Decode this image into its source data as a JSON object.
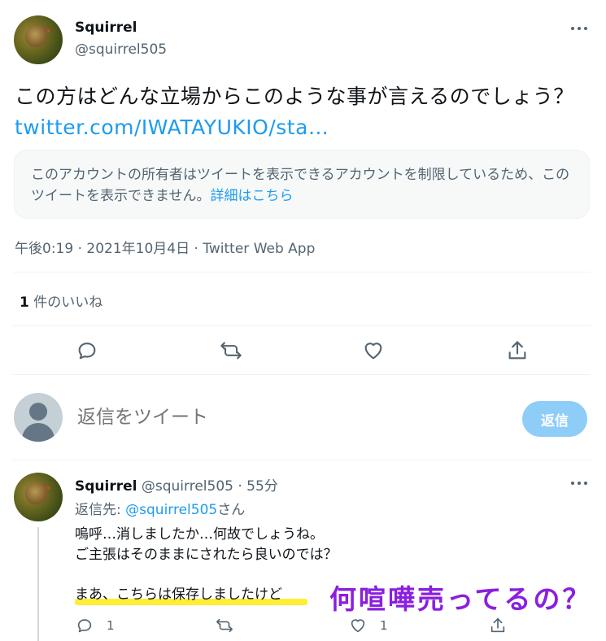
{
  "main_tweet": {
    "display_name": "Squirrel",
    "handle": "@squirrel505",
    "text": "この方はどんな立場からこのような事が言えるのでしょう？",
    "link": "twitter.com/IWATAYUKIO/sta…",
    "notice_text": "このアカウントの所有者はツイートを表示できるアカウントを制限しているため、このツイートを表示できません。",
    "notice_link": "詳細はこちら",
    "meta": "午後0:19 · 2021年10月4日 · Twitter Web App",
    "likes_count": "1",
    "likes_label": "件のいいね"
  },
  "compose": {
    "placeholder": "返信をツイート",
    "button_label": "返信"
  },
  "reply_tweet": {
    "display_name": "Squirrel",
    "handle": "@squirrel505",
    "time": "· 55分",
    "replying_prefix": "返信先:",
    "replying_handle": "@squirrel505",
    "replying_suffix": "さん",
    "line1": "嗚呼…消しましたか…何故でしょうね。",
    "line2": "ご主張はそのままにされたら良いのでは？",
    "line3": "まあ、こちらは保存しましたけど",
    "reply_count": "1",
    "like_count": "1"
  },
  "overlay_text": "何喧嘩売ってるの？",
  "icons": [
    "more-icon",
    "reply-icon",
    "retweet-icon",
    "like-icon",
    "share-icon",
    "default-avatar-icon"
  ],
  "colors": {
    "link": "#1d9bf0",
    "muted": "#536471",
    "button": "#8ecdf8",
    "overlay": "#8a1fe0",
    "highlight": "#ffee33"
  }
}
